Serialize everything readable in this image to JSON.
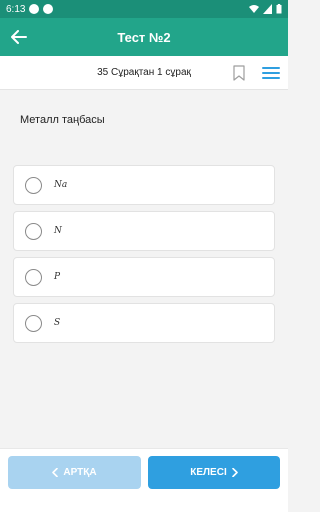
{
  "status": {
    "time": "6:13"
  },
  "appbar": {
    "title": "Тест №2"
  },
  "question_bar": {
    "counter": "35 Сұрақтан 1 сұрақ"
  },
  "question": {
    "text": "Металл таңбасы"
  },
  "options": [
    {
      "label": "Na"
    },
    {
      "label": "N"
    },
    {
      "label": "P"
    },
    {
      "label": "S"
    }
  ],
  "buttons": {
    "back": "АРТҚА",
    "next": "КЕЛЕСІ"
  },
  "colors": {
    "appbar": "#22a58a",
    "statusbar": "#1b8f78",
    "accent": "#2f9fe0",
    "disabled": "#a9d3f0"
  }
}
